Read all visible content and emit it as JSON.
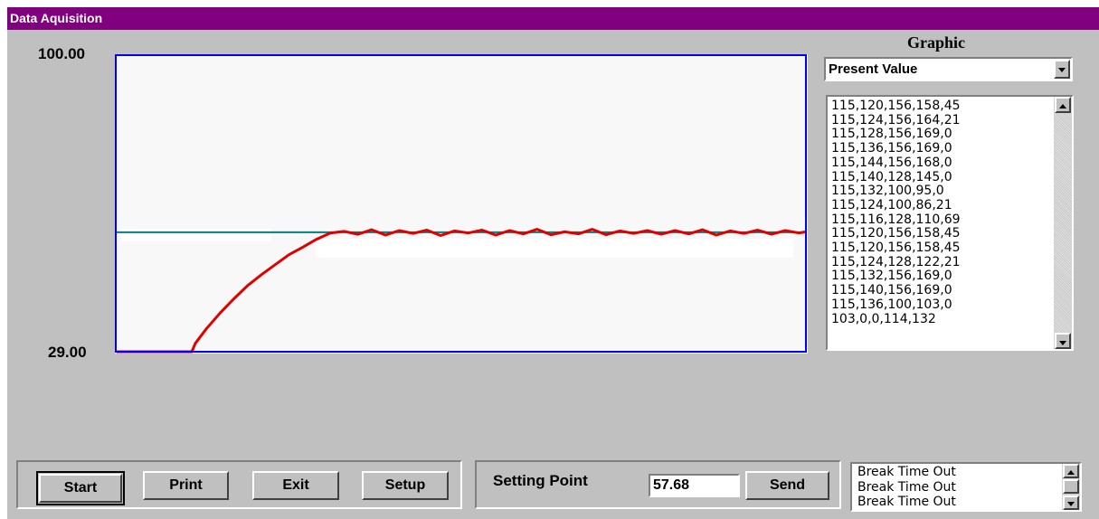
{
  "window": {
    "title": "Data Aquisition"
  },
  "chart": {
    "y_max_label": "100.00",
    "y_min_label": "29.00"
  },
  "chart_data": {
    "type": "line",
    "title": "",
    "xlabel": "",
    "ylabel": "",
    "ylim": [
      29,
      100
    ],
    "x_range": [
      0,
      100
    ],
    "setpoint": 57.68,
    "colors": {
      "present_value": "#e00000",
      "setpoint": "#008080",
      "frame": "#0000ff"
    },
    "series": [
      {
        "x": [
          0,
          10.9,
          11.4,
          13,
          15,
          17,
          19,
          21,
          23,
          25,
          27,
          29,
          31,
          33,
          35,
          37,
          39,
          41,
          43,
          45,
          47,
          49,
          51,
          53,
          55,
          57,
          59,
          61,
          63,
          65,
          67,
          69,
          71,
          73,
          75,
          77,
          79,
          81,
          83,
          85,
          87,
          89,
          91,
          93,
          95,
          97,
          99,
          100
        ],
        "y": [
          29.0,
          29.0,
          31.0,
          34.5,
          38.3,
          41.7,
          44.9,
          47.5,
          49.9,
          52.3,
          54.1,
          56.0,
          57.5,
          57.9,
          57.2,
          58.3,
          57.0,
          58.1,
          57.4,
          58.2,
          56.9,
          58.0,
          57.5,
          58.2,
          57.0,
          58.1,
          57.3,
          58.4,
          57.1,
          57.8,
          57.3,
          58.4,
          57.1,
          58.0,
          57.4,
          58.1,
          57.2,
          58.1,
          57.3,
          58.3,
          57.0,
          58.0,
          57.4,
          58.2,
          57.2,
          58.1,
          57.5,
          57.8
        ]
      }
    ]
  },
  "graphic_panel": {
    "title": "Graphic",
    "selected": "Present Value",
    "items": [
      "115,120,156,158,45",
      "115,124,156,164,21",
      "115,128,156,169,0",
      "115,136,156,169,0",
      "115,144,156,168,0",
      "115,140,128,145,0",
      "115,132,100,95,0",
      "115,124,100,86,21",
      "115,116,128,110,69",
      "115,120,156,158,45",
      "115,120,156,158,45",
      "115,124,128,122,21",
      "115,132,156,169,0",
      "115,140,156,169,0",
      "115,136,100,103,0",
      "103,0,0,114,132"
    ]
  },
  "buttons": {
    "start": "Start",
    "print": "Print",
    "exit": "Exit",
    "setup": "Setup",
    "send": "Send"
  },
  "setting_point": {
    "label": "Setting Point",
    "value": "57.68"
  },
  "log": {
    "items": [
      "Break Time Out",
      "Break Time Out",
      "Break Time Out"
    ]
  }
}
